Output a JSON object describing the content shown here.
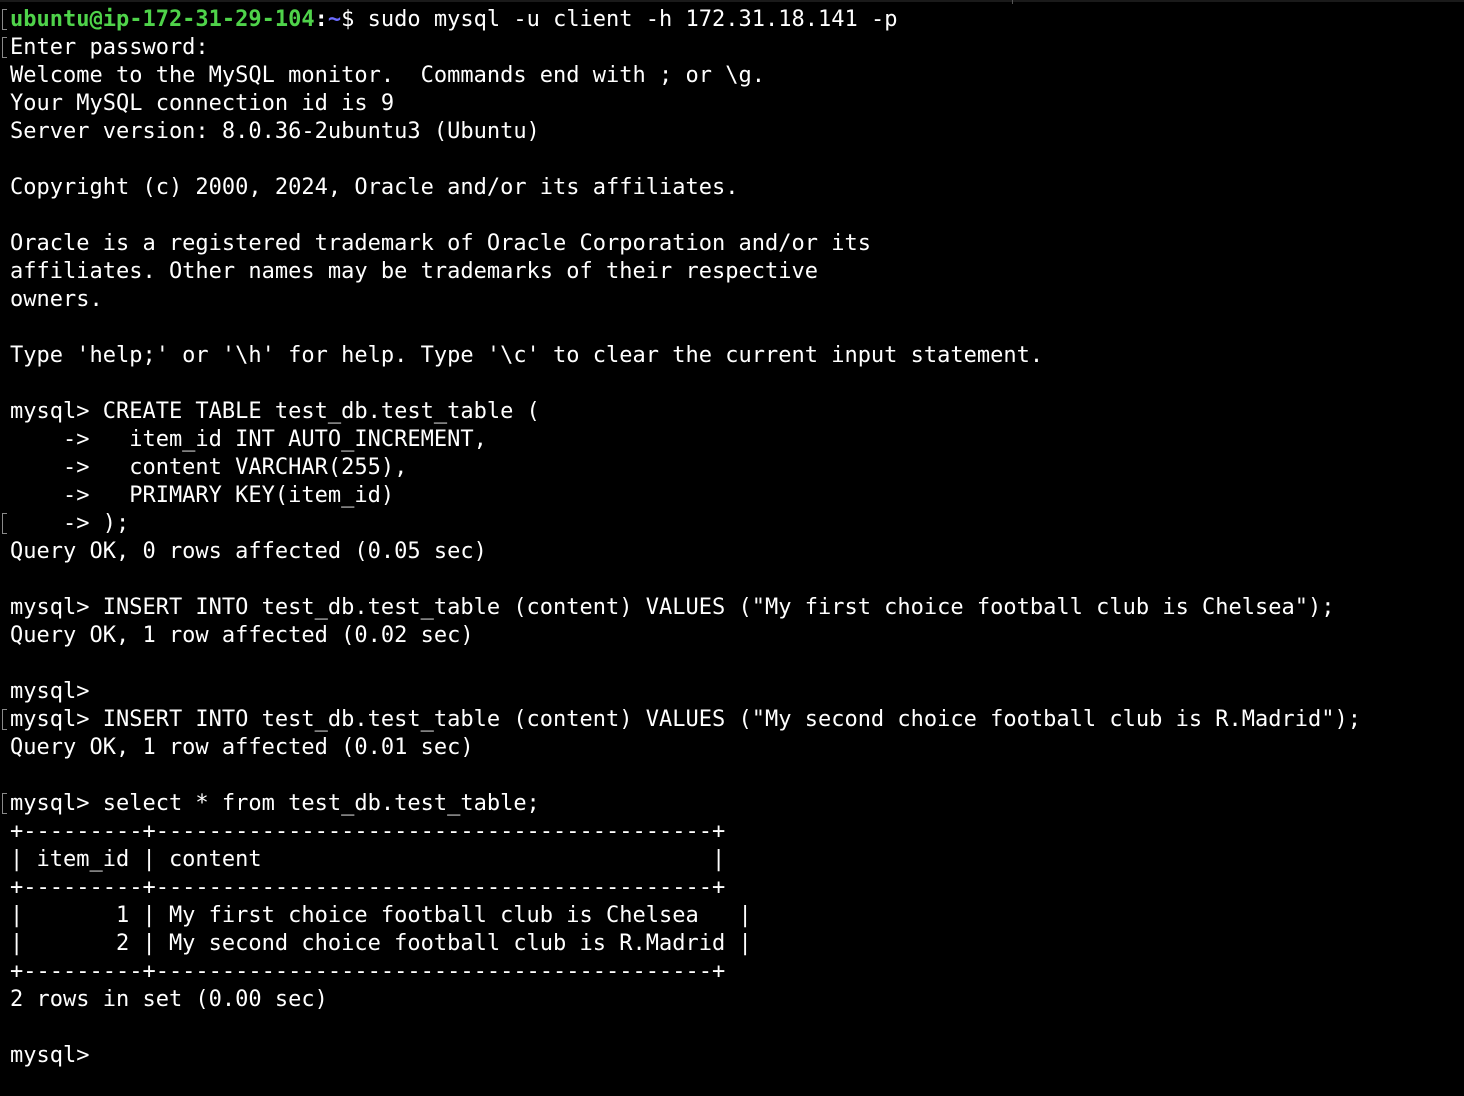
{
  "colors": {
    "background": "#000000",
    "text": "#ffffff",
    "prompt_user": "#4fd34a",
    "prompt_path": "#6b6bff"
  },
  "shell_prompt": {
    "user_host": "ubuntu@ip-172-31-29-104",
    "separator": ":",
    "path": "~",
    "symbol": "$",
    "command": " sudo mysql -u client -h 172.31.18.141 -p"
  },
  "lines": [
    "Enter password:",
    "Welcome to the MySQL monitor.  Commands end with ; or \\g.",
    "Your MySQL connection id is 9",
    "Server version: 8.0.36-2ubuntu3 (Ubuntu)",
    "",
    "Copyright (c) 2000, 2024, Oracle and/or its affiliates.",
    "",
    "Oracle is a registered trademark of Oracle Corporation and/or its",
    "affiliates. Other names may be trademarks of their respective",
    "owners.",
    "",
    "Type 'help;' or '\\h' for help. Type '\\c' to clear the current input statement.",
    "",
    "mysql> CREATE TABLE test_db.test_table (",
    "    ->   item_id INT AUTO_INCREMENT,",
    "    ->   content VARCHAR(255),",
    "    ->   PRIMARY KEY(item_id)",
    "    -> );",
    "Query OK, 0 rows affected (0.05 sec)",
    "",
    "mysql> INSERT INTO test_db.test_table (content) VALUES (\"My first choice football club is Chelsea\");",
    "Query OK, 1 row affected (0.02 sec)",
    "",
    "mysql>",
    "mysql> INSERT INTO test_db.test_table (content) VALUES (\"My second choice football club is R.Madrid\");",
    "Query OK, 1 row affected (0.01 sec)",
    "",
    "mysql> select * from test_db.test_table;",
    "+---------+------------------------------------------+",
    "| item_id | content                                  |",
    "+---------+------------------------------------------+",
    "|       1 | My first choice football club is Chelsea   |",
    "|       2 | My second choice football club is R.Madrid |",
    "+---------+------------------------------------------+",
    "2 rows in set (0.00 sec)",
    "",
    "mysql>"
  ]
}
